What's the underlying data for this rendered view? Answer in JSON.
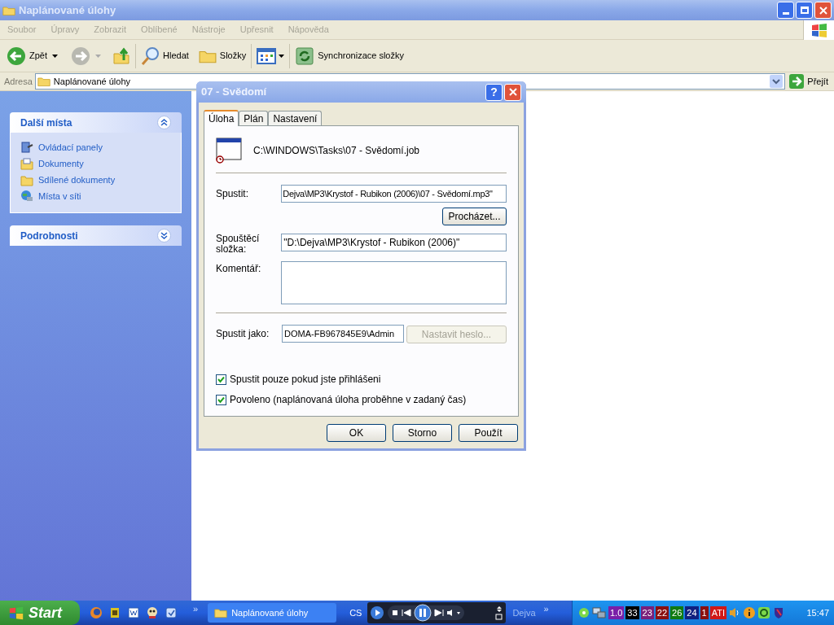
{
  "window": {
    "title": "Naplánované úlohy"
  },
  "menu": [
    "Soubor",
    "Úpravy",
    "Zobrazit",
    "Oblíbené",
    "Nástroje",
    "Upřesnit",
    "Nápověda"
  ],
  "toolbar": {
    "back": "Zpět",
    "search": "Hledat",
    "folders": "Složky",
    "sync": "Synchronizace složky"
  },
  "address": {
    "label": "Adresa",
    "value": "Naplánované úlohy",
    "go": "Přejít"
  },
  "sidebar": [
    {
      "title": "Další místa",
      "expanded": true,
      "items": [
        {
          "label": "Ovládací panely",
          "kind": "control"
        },
        {
          "label": "Dokumenty",
          "kind": "documents"
        },
        {
          "label": "Sdílené dokumenty",
          "kind": "folder"
        },
        {
          "label": "Místa v síti",
          "kind": "network"
        }
      ]
    },
    {
      "title": "Podrobnosti",
      "expanded": false
    }
  ],
  "dialog": {
    "title": "07 - Svědomí",
    "help": "?",
    "tabs": [
      {
        "label": "Úloha",
        "selected": true
      },
      {
        "label": "Plán",
        "selected": false
      },
      {
        "label": "Nastavení",
        "selected": false
      }
    ],
    "path": "C:\\WINDOWS\\Tasks\\07 - Svědomí.job",
    "run_label": "Spustit:",
    "run_value": "Dejva\\MP3\\Krystof - Rubikon (2006)\\07 - Svědomí.mp3\"",
    "browse": {
      "label": "Procházet...",
      "disabled": false
    },
    "start_label": "Spouštěcí složka:",
    "start_value": "\"D:\\Dejva\\MP3\\Krystof - Rubikon (2006)\"",
    "comment_label": "Komentář:",
    "runas_label": "Spustit jako:",
    "runas_value": "DOMA-FB967845E9\\Admin",
    "password": {
      "label": "Nastavit heslo...",
      "disabled": true
    },
    "checks": [
      {
        "label": "Spustit pouze pokud jste přihlášeni",
        "checked": true
      },
      {
        "label": "Povoleno (naplánovaná úloha proběhne v zadaný čas)",
        "checked": true
      }
    ],
    "buttons": [
      "OK",
      "Storno",
      "Použít"
    ]
  },
  "taskbar": {
    "start": "Start",
    "quick_more": "»",
    "task": "Naplánované úlohy",
    "language": "CS",
    "player_title": "Dejva",
    "player_more": "»",
    "tray": [
      {
        "text": "1.0",
        "color": "#7a1fa8"
      },
      {
        "text": "33",
        "color": "#000000"
      },
      {
        "text": "23",
        "color": "#7a1f7a"
      },
      {
        "text": "22",
        "color": "#8a1010"
      },
      {
        "text": "26",
        "color": "#107a10"
      },
      {
        "text": "24",
        "color": "#102080"
      },
      {
        "text": "1",
        "color": "#8a1010"
      },
      {
        "text": "ATI",
        "color": "#d01818"
      }
    ],
    "clock": "15:47"
  }
}
